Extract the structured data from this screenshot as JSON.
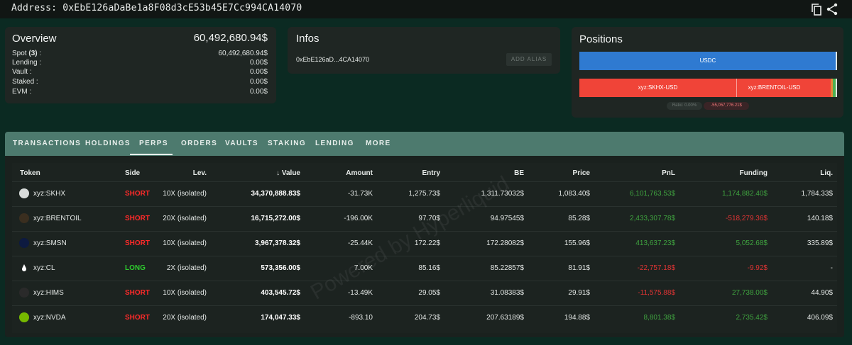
{
  "header": {
    "address_label": "Address:",
    "address": "0xEbE126aDaBe1a8F08d3cE53b45E7Cc994CA14070",
    "copy_icon": "copy-icon",
    "share_icon": "share-icon"
  },
  "overview": {
    "title": "Overview",
    "total": "60,492,680.94$",
    "rows": [
      {
        "label_prefix": "Spot ",
        "label_count": "(3)",
        "label_suffix": " :",
        "value": "60,492,680.94$"
      },
      {
        "label": "Lending :",
        "value": "0.00$"
      },
      {
        "label": "Vault :",
        "value": "0.00$"
      },
      {
        "label": "Staked :",
        "value": "0.00$"
      },
      {
        "label": "EVM :",
        "value": "0.00$"
      }
    ]
  },
  "infos": {
    "title": "Infos",
    "address_short": "0xEbE126aD...4CA14070",
    "add_alias": "ADD ALIAS"
  },
  "positions": {
    "title": "Positions",
    "long_bar_label": "USDC",
    "short_bar_labels": [
      "xyz:SKHX-USD",
      "xyz:BRENTOIL-USD"
    ],
    "ratio_label": "Ratio: 0.00%",
    "net_value": "-55,057,776.21$",
    "colors": {
      "long": "#2f7ad1",
      "short": "#f04438",
      "accent_green": "#4caf50",
      "accent_orange": "#e08a3a"
    }
  },
  "tabs": [
    "TRANSACTIONS",
    "HOLDINGS",
    "PERPS",
    "ORDERS",
    "VAULTS",
    "STAKING",
    "LENDING",
    "MORE"
  ],
  "active_tab": "PERPS",
  "table": {
    "headers": [
      "Token",
      "Side",
      "Lev.",
      "Value",
      "Amount",
      "Entry",
      "BE",
      "Price",
      "PnL",
      "Funding",
      "Liq."
    ],
    "sort_icon": "arrow-down-icon",
    "rows": [
      {
        "token": "xyz:SKHX",
        "side": "SHORT",
        "lev": "10X (isolated)",
        "value": "34,370,888.83$",
        "amount": "-31.73K",
        "entry": "1,275.73$",
        "be": "1,311.73032$",
        "price": "1,083.40$",
        "pnl": "6,101,763.53$",
        "pnl_sign": "pos",
        "funding": "1,174,882.40$",
        "funding_sign": "pos",
        "liq": "1,784.33$",
        "icon": "skhx-icon"
      },
      {
        "token": "xyz:BRENTOIL",
        "side": "SHORT",
        "lev": "20X (isolated)",
        "value": "16,715,272.00$",
        "amount": "-196.00K",
        "entry": "97.70$",
        "be": "94.97545$",
        "price": "85.28$",
        "pnl": "2,433,307.78$",
        "pnl_sign": "pos",
        "funding": "-518,279.36$",
        "funding_sign": "neg",
        "liq": "140.18$",
        "icon": "oil-drop-icon"
      },
      {
        "token": "xyz:SMSN",
        "side": "SHORT",
        "lev": "10X (isolated)",
        "value": "3,967,378.32$",
        "amount": "-25.44K",
        "entry": "172.22$",
        "be": "172.28082$",
        "price": "155.96$",
        "pnl": "413,637.23$",
        "pnl_sign": "pos",
        "funding": "5,052.68$",
        "funding_sign": "pos",
        "liq": "335.89$",
        "icon": "samsung-icon"
      },
      {
        "token": "xyz:CL",
        "side": "LONG",
        "lev": "2X (isolated)",
        "value": "573,356.00$",
        "amount": "7.00K",
        "entry": "85.16$",
        "be": "85.22857$",
        "price": "81.91$",
        "pnl": "-22,757.18$",
        "pnl_sign": "neg",
        "funding": "-9.92$",
        "funding_sign": "neg",
        "liq": "-",
        "icon": "drop-icon"
      },
      {
        "token": "xyz:HIMS",
        "side": "SHORT",
        "lev": "10X (isolated)",
        "value": "403,545.72$",
        "amount": "-13.49K",
        "entry": "29.05$",
        "be": "31.08383$",
        "price": "29.91$",
        "pnl": "-11,575.88$",
        "pnl_sign": "neg",
        "funding": "27,738.00$",
        "funding_sign": "pos",
        "liq": "44.90$",
        "icon": "hims-icon"
      },
      {
        "token": "xyz:NVDA",
        "side": "SHORT",
        "lev": "20X (isolated)",
        "value": "174,047.33$",
        "amount": "-893.10",
        "entry": "204.73$",
        "be": "207.63189$",
        "price": "194.88$",
        "pnl": "8,801.38$",
        "pnl_sign": "pos",
        "funding": "2,735.42$",
        "funding_sign": "pos",
        "liq": "406.09$",
        "icon": "nvidia-icon"
      }
    ]
  },
  "watermark": "Powered by Hyperliquid"
}
